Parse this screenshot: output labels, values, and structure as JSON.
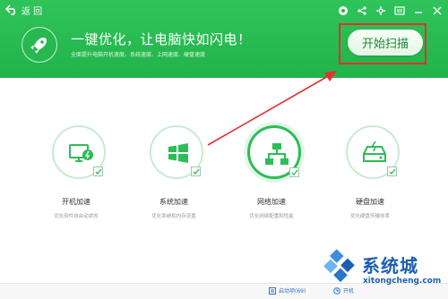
{
  "header": {
    "back_label": "返 回",
    "headline": "一键优化，让电脑快如闪电！",
    "subline": "全面提升电脑开机速度、系统速度、上网速度、硬盘速度",
    "scan_button": "开始扫描"
  },
  "items": [
    {
      "title": "开机加速",
      "desc": "优化软件自启动状态",
      "icon": "monitor-boost-icon",
      "checked": true
    },
    {
      "title": "系统加速",
      "desc": "优化系统和内存设置",
      "icon": "windows-icon",
      "checked": true
    },
    {
      "title": "网络加速",
      "desc": "优化网络配置和性能",
      "icon": "network-icon",
      "checked": true
    },
    {
      "title": "硬盘加速",
      "desc": "优化硬盘传输效率",
      "icon": "harddisk-icon",
      "checked": true
    }
  ],
  "footer": {
    "startup_items": "启动项(69)",
    "right_item": "开机"
  },
  "watermark": {
    "brand": "系统城",
    "url": "xitongcheng.com"
  },
  "colors": {
    "header_green": "#22b34a",
    "accent_green": "#2ebc56",
    "annotation_red": "#e03131",
    "watermark_blue": "#1b5fb0"
  }
}
